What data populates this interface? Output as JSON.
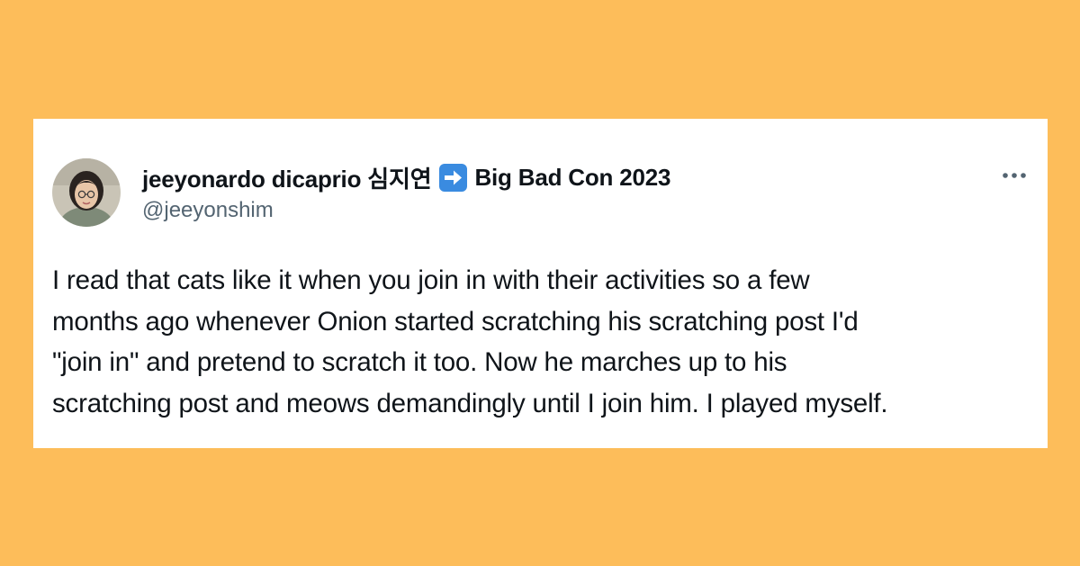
{
  "theme": {
    "page_background": "#FDBD5A",
    "card_background": "#FFFFFF",
    "text_primary": "#0F1419",
    "text_secondary": "#536471",
    "emoji_blue": "#3A8BE0"
  },
  "tweet": {
    "author": {
      "display_name_part1": "jeeyonardo dicaprio 심지연",
      "emoji": "arrow-right-emoji",
      "display_name_part2": "Big Bad Con 2023",
      "handle": "@jeeyonshim",
      "avatar_icon": "profile-photo"
    },
    "more_icon": "more-horizontal-icon",
    "text_lines": [
      "I read that cats like it when you join in with their activities so a few",
      "months ago whenever Onion started scratching his scratching post I'd",
      "\"join in\" and pretend to scratch it too. Now he marches up to his",
      "scratching post and meows demandingly until I join him. I played myself."
    ]
  }
}
